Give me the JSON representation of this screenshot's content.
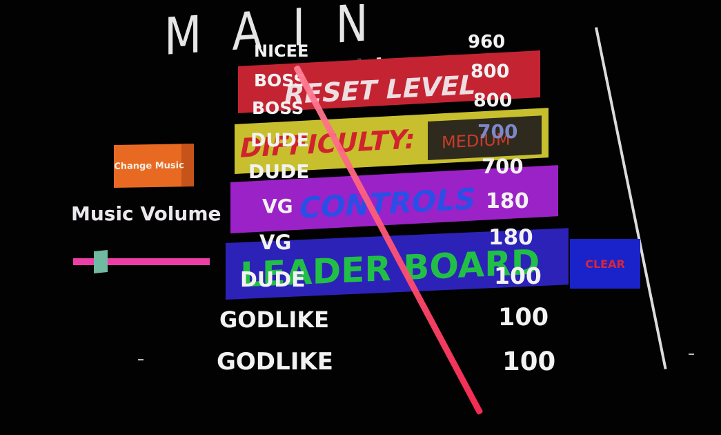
{
  "menu": {
    "title": "MAIN MENU",
    "reset_level": "RESET LEVEL",
    "difficulty_label": "DIFFICULTY:",
    "difficulty_value": "MEDIUM",
    "controls": "CONTROLS",
    "leader_board": "LEADER BOARD"
  },
  "music": {
    "change_music": "Change Music",
    "volume_label": "Music Volume",
    "volume_level": 0.2
  },
  "leaderboard": {
    "clear_label": "CLEAR",
    "entries": [
      {
        "name": "NICEE",
        "score": "960"
      },
      {
        "name": "BOSS",
        "score": "800"
      },
      {
        "name": "BOSS",
        "score": "800"
      },
      {
        "name": "DUDE",
        "score": "700"
      },
      {
        "name": "DUDE",
        "score": "700"
      },
      {
        "name": "VG",
        "score": "180"
      },
      {
        "name": "VG",
        "score": "180"
      },
      {
        "name": "DUDE",
        "score": "100"
      },
      {
        "name": "GODLIKE",
        "score": "100"
      },
      {
        "name": "GODLIKE",
        "score": "100"
      }
    ]
  },
  "colors": {
    "reset_button": "#c42432",
    "difficulty_button": "#c7bf2e",
    "controls_button": "#9b22c7",
    "leaderboard_button": "#2c22b8",
    "clear_button": "#1a23c9",
    "laser_pointer": "#ff2d57"
  }
}
